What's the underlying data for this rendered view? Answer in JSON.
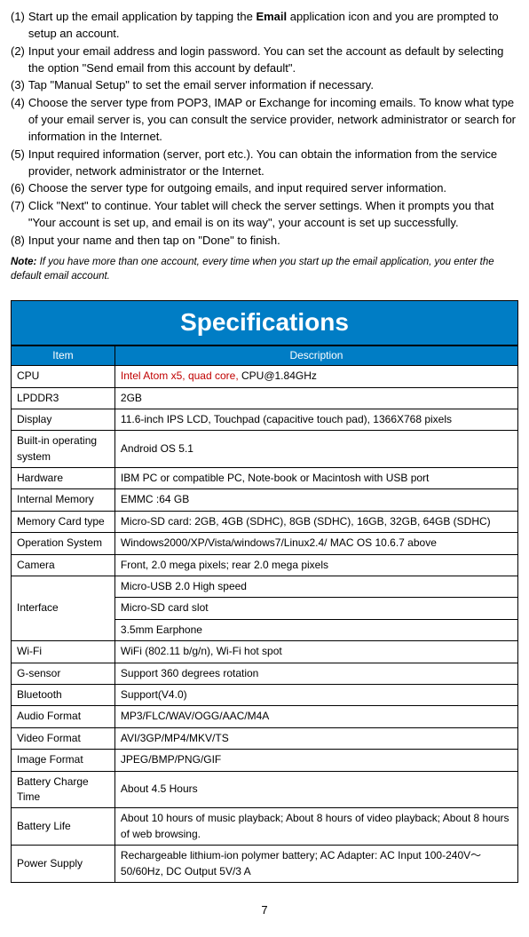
{
  "steps": [
    {
      "num": "(1)",
      "segments": [
        "Start up the email application by tapping the ",
        {
          "bold": true,
          "text": "Email"
        },
        " application icon and you are prompted to setup an account."
      ]
    },
    {
      "num": "(2)",
      "text": "Input your email address and login password. You can set the account as default by selecting the option \"Send email from this account by default\"."
    },
    {
      "num": "(3)",
      "text": "Tap \"Manual Setup\" to set the email server information if necessary."
    },
    {
      "num": "(4)",
      "text": "Choose the server type from POP3, IMAP or Exchange for incoming emails. To know what type of your email server is, you can consult the service provider, network administrator or search for information in the Internet."
    },
    {
      "num": "(5)",
      "text": "Input required information (server, port etc.). You can obtain the information from the service provider, network administrator or the Internet."
    },
    {
      "num": "(6)",
      "text": "Choose the server type for outgoing emails, and input required server information."
    },
    {
      "num": "(7)",
      "text": "Click \"Next\" to continue. Your tablet will check the server settings. When it prompts you that \"Your account is set up, and email is on its way\", your account is set up successfully."
    },
    {
      "num": "(8)",
      "text": "Input your name and then tap on \"Done\" to finish."
    }
  ],
  "note_label": "Note:",
  "note_text": " If you have more than one account, every time when you start up the email application, you enter the default email account.",
  "spec_title": "Specifications",
  "spec_headers": {
    "item": "Item",
    "desc": "Description"
  },
  "spec_rows": [
    {
      "item": "CPU",
      "segments": [
        {
          "red": true,
          "text": "Intel Atom x5, quad core,"
        },
        " CPU@1.84GHz"
      ]
    },
    {
      "item": "LPDDR3",
      "desc": "2GB"
    },
    {
      "item": "Display",
      "desc": "11.6-inch IPS LCD, Touchpad (capacitive touch pad), 1366X768 pixels"
    },
    {
      "item": "Built-in operating system",
      "desc": "Android OS 5.1"
    },
    {
      "item": "Hardware",
      "desc": "IBM PC or compatible PC, Note-book or Macintosh with USB port"
    },
    {
      "item": "Internal Memory",
      "desc": "EMMC :64 GB"
    },
    {
      "item": "Memory Card type",
      "desc": "Micro-SD card: 2GB, 4GB (SDHC), 8GB (SDHC), 16GB, 32GB, 64GB (SDHC)"
    },
    {
      "item": "Operation System",
      "desc": "Windows2000/XP/Vista/windows7/Linux2.4/ MAC OS 10.6.7 above"
    },
    {
      "item": "Camera",
      "desc": "Front, 2.0 mega pixels; rear 2.0 mega pixels"
    },
    {
      "item": "Interface",
      "multi": [
        "Micro-USB 2.0 High speed",
        "Micro-SD card slot",
        "3.5mm Earphone"
      ]
    },
    {
      "item": "Wi-Fi",
      "desc": "WiFi (802.11 b/g/n), Wi-Fi hot spot"
    },
    {
      "item": "G-sensor",
      "desc": "Support 360 degrees rotation"
    },
    {
      "item": "Bluetooth",
      "desc": "Support(V4.0)"
    },
    {
      "item": "Audio Format",
      "desc": "MP3/FLC/WAV/OGG/AAC/M4A"
    },
    {
      "item": "Video Format",
      "desc": "AVI/3GP/MP4/MKV/TS"
    },
    {
      "item": "Image Format",
      "desc": "JPEG/BMP/PNG/GIF"
    },
    {
      "item": "Battery Charge Time",
      "desc": "About 4.5 Hours"
    },
    {
      "item": "Battery Life",
      "desc": "About 10  hours of music playback; About  8  hours of video playback; About  8  hours of web browsing."
    },
    {
      "item": "Power Supply",
      "desc": "Rechargeable lithium-ion polymer battery;\nAC Adapter: AC Input 100-240V～50/60Hz, DC Output 5V/3 A"
    }
  ],
  "page_number": "7"
}
